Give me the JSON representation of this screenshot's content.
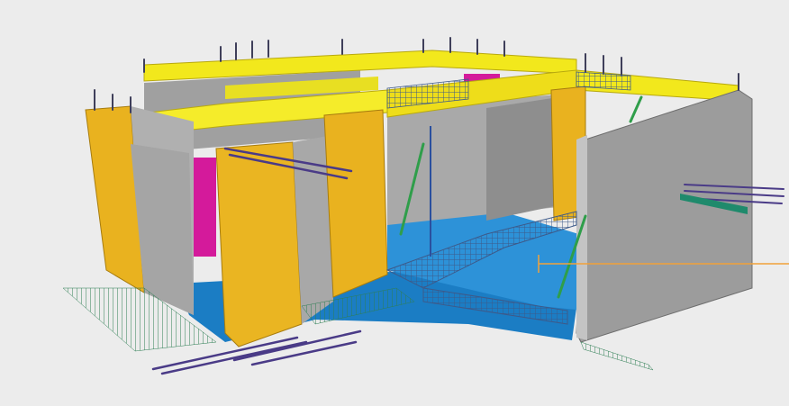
{
  "scene": {
    "subject": "bim-model-precast-walls",
    "colors": {
      "background": "#ececec",
      "wall_yellow": "#e9b21f",
      "beam_yellow": "#f2e81c",
      "concrete_gray": "#9e9e9e",
      "slab_blue": "#1e88d6",
      "accent_magenta": "#d41a9b",
      "rebar_dark": "#4a3b87",
      "rebar_green": "#1f8a6c",
      "callout_orange": "#f2a23a"
    }
  }
}
